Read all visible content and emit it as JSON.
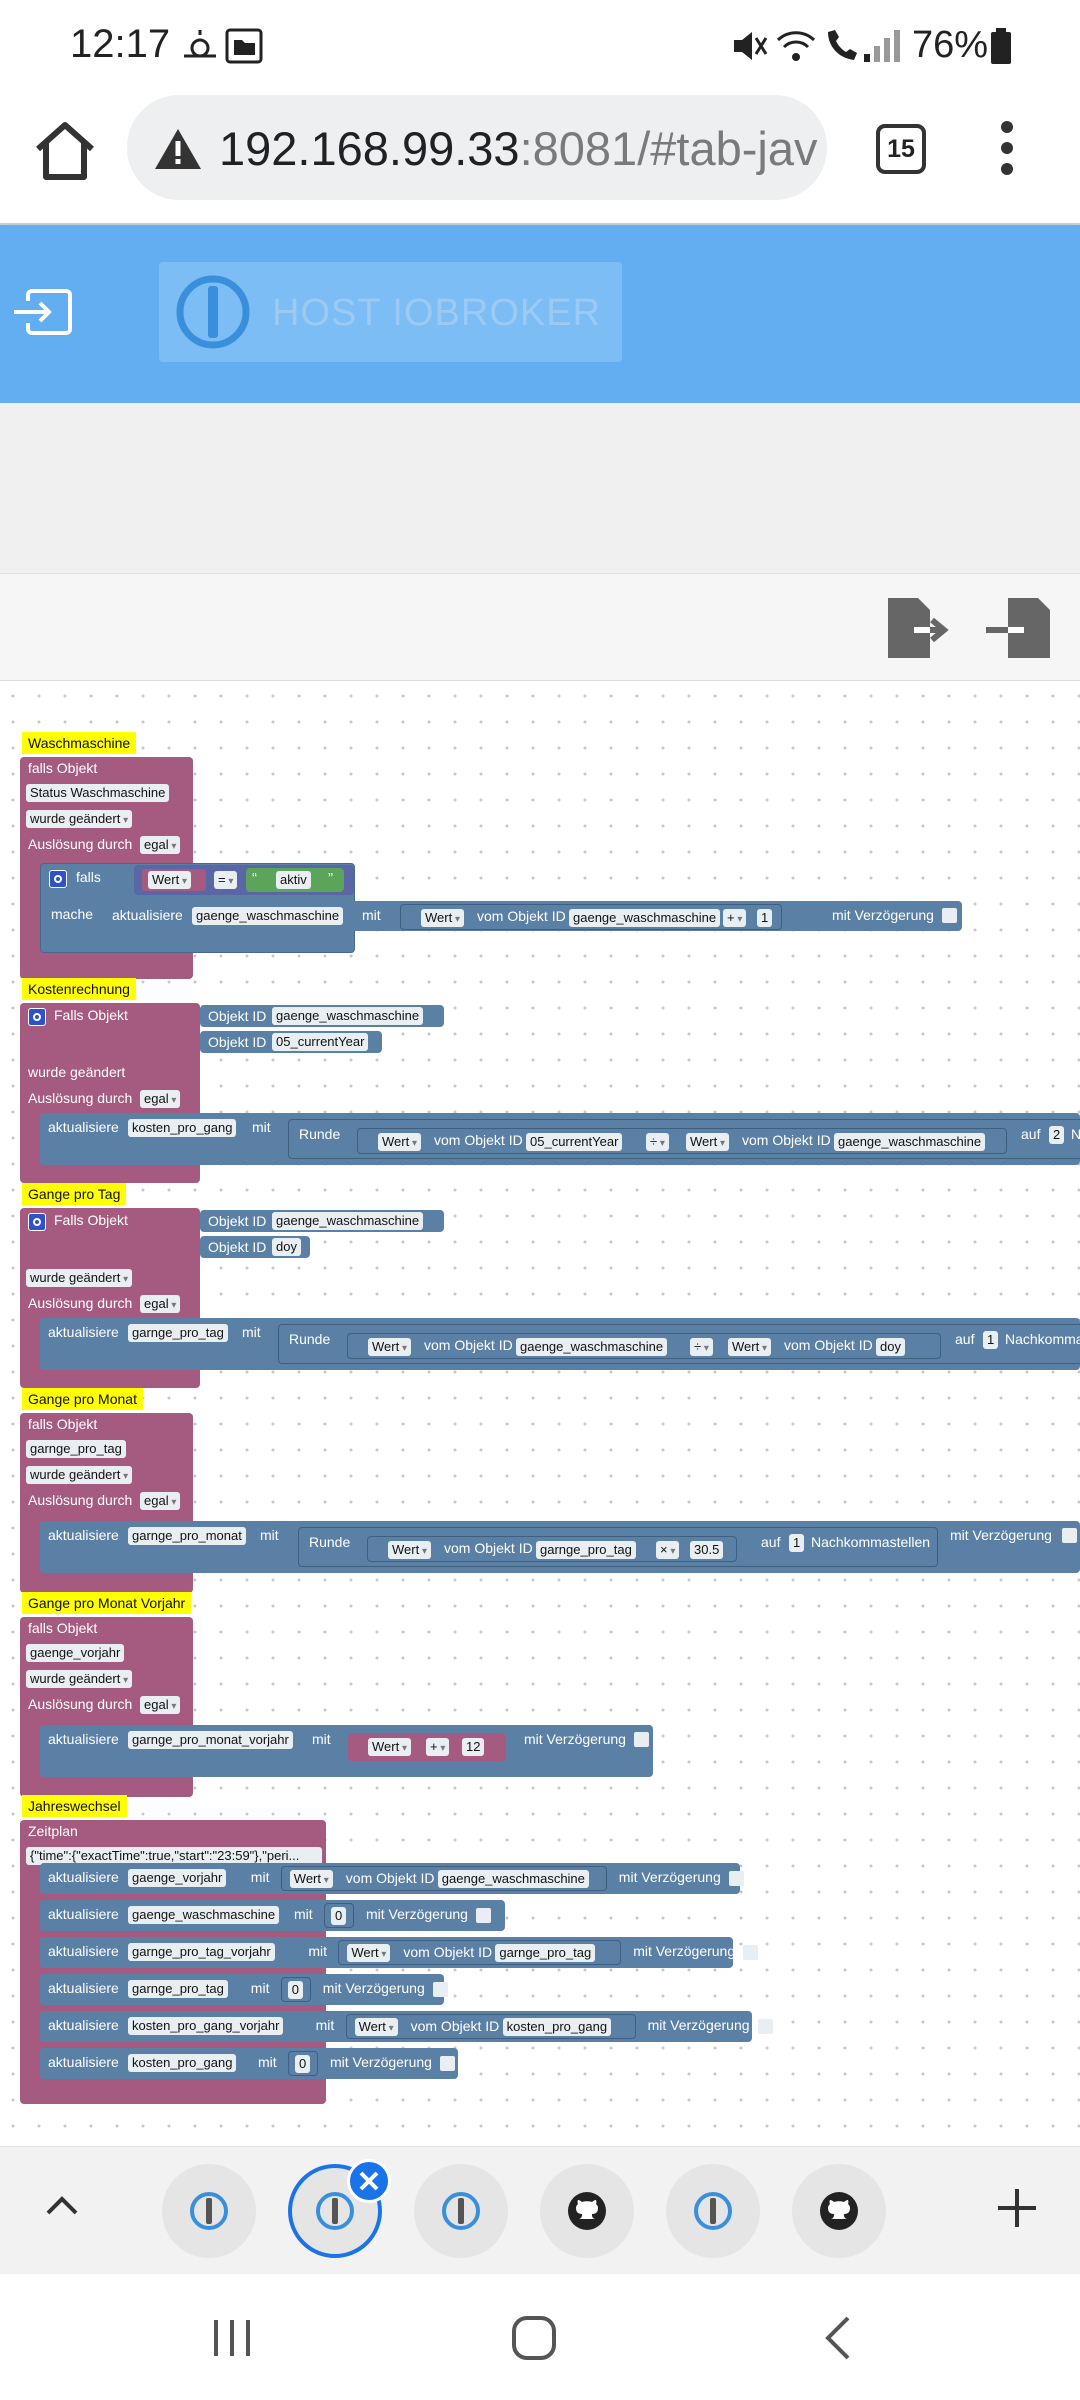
{
  "status_bar": {
    "time": "12:17",
    "battery": "76%",
    "icons": [
      "weather-icon",
      "folder-icon",
      "mute-icon",
      "wifi-icon",
      "wifi-call-icon",
      "signal-icon",
      "battery-icon"
    ]
  },
  "browser": {
    "url_host": "192.168.99.33",
    "url_rest": ":8081/#tab-jav",
    "tab_count": "15",
    "icons": [
      "home-icon",
      "warning-icon",
      "tabs-icon",
      "menu-icon"
    ]
  },
  "app": {
    "host_label": "HOST IOBROKER",
    "colors": {
      "header": "#62aef0",
      "event_block": "#a55b80",
      "action_block": "#5b80a5",
      "comment": "#ffff00"
    }
  },
  "blocks": {
    "waschmaschine": {
      "title": "Waschmaschine",
      "falls_objekt": "falls Objekt",
      "object": "Status Waschmaschine",
      "trigger": "wurde geändert",
      "ausloesung": "Auslösung durch",
      "egal": "egal",
      "falls": "falls",
      "wert": "Wert",
      "eq": "=",
      "aktiv": "aktiv",
      "mache": "mache",
      "aktualisiere": "aktualisiere",
      "var": "gaenge_waschmaschine",
      "mit": "mit",
      "wert2": "Wert",
      "vom_objekt": "vom Objekt ID",
      "obj2": "gaenge_waschmaschine",
      "op": "+",
      "num": "1",
      "delay": "mit Verzögerung"
    },
    "kosten": {
      "title": "Kostenrechnung",
      "falls_objekt": "Falls Objekt",
      "objekt_id": "Objekt ID",
      "obj1": "gaenge_waschmaschine",
      "objekt_id2": "Objekt ID",
      "obj2": "05_currentYear",
      "trigger": "wurde geändert",
      "ausloesung": "Auslösung durch",
      "egal": "egal",
      "aktualisiere": "aktualisiere",
      "var": "kosten_pro_gang",
      "mit": "mit",
      "runde": "Runde",
      "wert": "Wert",
      "vom_objekt": "vom Objekt ID",
      "o1": "05_currentYear",
      "op": "÷",
      "wert2": "Wert",
      "vom_objekt2": "vom Objekt ID",
      "o2": "gaenge_waschmaschine",
      "auf": "auf",
      "digits": "2",
      "nachk": "N"
    },
    "tag": {
      "title": "Gange pro Tag",
      "falls_objekt": "Falls Objekt",
      "objekt_id": "Objekt ID",
      "obj1": "gaenge_waschmaschine",
      "objekt_id2": "Objekt ID",
      "obj2": "doy",
      "trigger": "wurde geändert",
      "ausloesung": "Auslösung durch",
      "egal": "egal",
      "aktualisiere": "aktualisiere",
      "var": "garnge_pro_tag",
      "mit": "mit",
      "runde": "Runde",
      "wert": "Wert",
      "vom_objekt": "vom Objekt ID",
      "o1": "gaenge_waschmaschine",
      "op": "÷",
      "wert2": "Wert",
      "vom_objekt2": "vom Objekt ID",
      "o2": "doy",
      "auf": "auf",
      "digits": "1",
      "nachk": "Nachkommast"
    },
    "monat": {
      "title": "Gange pro Monat",
      "falls_objekt": "falls Objekt",
      "object": "garnge_pro_tag",
      "trigger": "wurde geändert",
      "ausloesung": "Auslösung durch",
      "egal": "egal",
      "aktualisiere": "aktualisiere",
      "var": "garnge_pro_monat",
      "mit": "mit",
      "runde": "Runde",
      "wert": "Wert",
      "vom_objekt": "vom Objekt ID",
      "o1": "garnge_pro_tag",
      "op": "×",
      "num": "30.5",
      "auf": "auf",
      "digits": "1",
      "nachk": "Nachkommastellen",
      "delay": "mit Verzögerung"
    },
    "vorjahr": {
      "title": "Gange pro Monat Vorjahr",
      "falls_objekt": "falls Objekt",
      "object": "gaenge_vorjahr",
      "trigger": "wurde geändert",
      "ausloesung": "Auslösung durch",
      "egal": "egal",
      "aktualisiere": "aktualisiere",
      "var": "garnge_pro_monat_vorjahr",
      "mit": "mit",
      "wert": "Wert",
      "op": "+",
      "num": "12",
      "delay": "mit Verzögerung"
    },
    "jahr": {
      "title": "Jahreswechsel",
      "zeitplan": "Zeitplan",
      "schedule": "{\"time\":{\"exactTime\":true,\"start\":\"23:59\"},\"peri...",
      "rows": [
        {
          "aktualisiere": "aktualisiere",
          "var": "gaenge_vorjahr",
          "mit": "mit",
          "wert": "Wert",
          "vom": "vom Objekt ID",
          "obj": "gaenge_waschmaschine",
          "val": "",
          "delay": "mit Verzögerung"
        },
        {
          "aktualisiere": "aktualisiere",
          "var": "gaenge_waschmaschine",
          "mit": "mit",
          "wert": "",
          "vom": "",
          "obj": "",
          "val": "0",
          "delay": "mit Verzögerung"
        },
        {
          "aktualisiere": "aktualisiere",
          "var": "garnge_pro_tag_vorjahr",
          "mit": "mit",
          "wert": "Wert",
          "vom": "vom Objekt ID",
          "obj": "garnge_pro_tag",
          "val": "",
          "delay": "mit Verzögerung"
        },
        {
          "aktualisiere": "aktualisiere",
          "var": "garnge_pro_tag",
          "mit": "mit",
          "wert": "",
          "vom": "",
          "obj": "",
          "val": "0",
          "delay": "mit Verzögerung"
        },
        {
          "aktualisiere": "aktualisiere",
          "var": "kosten_pro_gang_vorjahr",
          "mit": "mit",
          "wert": "Wert",
          "vom": "vom Objekt ID",
          "obj": "kosten_pro_gang",
          "val": "",
          "delay": "mit Verzögerung"
        },
        {
          "aktualisiere": "aktualisiere",
          "var": "kosten_pro_gang",
          "mit": "mit",
          "wert": "",
          "vom": "",
          "obj": "",
          "val": "0",
          "delay": "mit Verzögerung"
        }
      ]
    }
  },
  "tabstrip": {
    "tabs": [
      "iobroker-icon",
      "iobroker-icon",
      "iobroker-icon",
      "github-icon",
      "iobroker-icon",
      "github-icon"
    ],
    "active_index": 1
  }
}
